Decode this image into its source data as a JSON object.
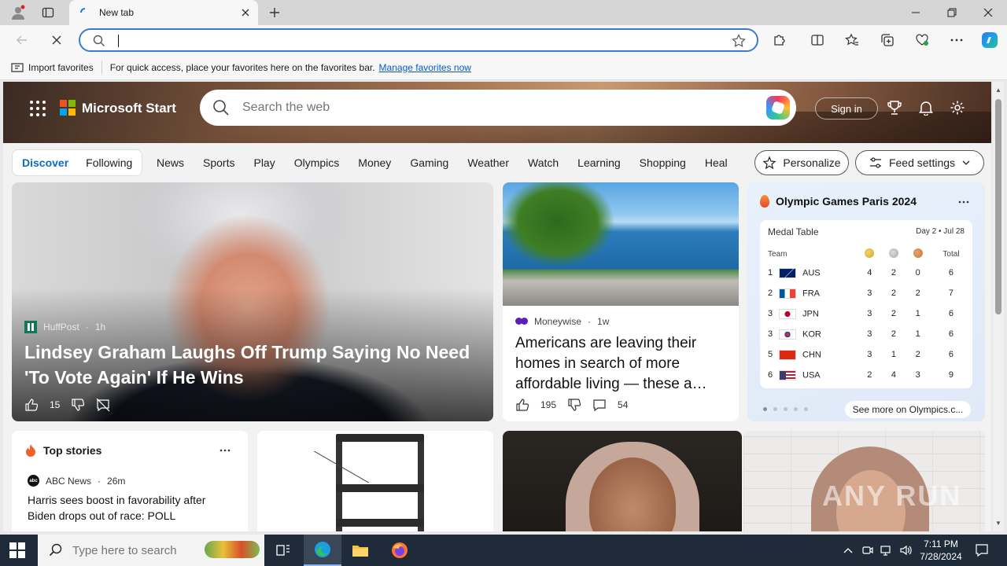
{
  "browser": {
    "tab_title": "New tab",
    "address_value": "",
    "favorites_bar": {
      "import_label": "Import favorites",
      "hint": "For quick access, place your favorites here on the favorites bar.",
      "manage_link": "Manage favorites now"
    }
  },
  "header": {
    "brand": "Microsoft Start",
    "search_placeholder": "Search the web",
    "sign_in": "Sign in"
  },
  "nav": {
    "discover": "Discover",
    "following": "Following",
    "items": [
      "News",
      "Sports",
      "Play",
      "Olympics",
      "Money",
      "Gaming",
      "Weather",
      "Watch",
      "Learning",
      "Shopping",
      "Heal"
    ],
    "personalize": "Personalize",
    "feed_settings": "Feed settings"
  },
  "lead_story": {
    "source": "HuffPost",
    "age": "1h",
    "headline": "Lindsey Graham Laughs Off Trump Saying No Need 'To Vote Again' If He Wins",
    "likes": "15"
  },
  "money_story": {
    "source": "Moneywise",
    "age": "1w",
    "headline": "Americans are leaving their homes in search of more affordable living — these a…",
    "likes": "195",
    "comments": "54"
  },
  "olympics": {
    "title": "Olympic Games Paris 2024",
    "table_title": "Medal Table",
    "day": "Day 2 • Jul 28",
    "team_header": "Team",
    "total_header": "Total",
    "rows": [
      {
        "rank": "1",
        "team": "AUS",
        "gold": "4",
        "silver": "2",
        "bronze": "0",
        "total": "6"
      },
      {
        "rank": "2",
        "team": "FRA",
        "gold": "3",
        "silver": "2",
        "bronze": "2",
        "total": "7"
      },
      {
        "rank": "3",
        "team": "JPN",
        "gold": "3",
        "silver": "2",
        "bronze": "1",
        "total": "6"
      },
      {
        "rank": "3",
        "team": "KOR",
        "gold": "3",
        "silver": "2",
        "bronze": "1",
        "total": "6"
      },
      {
        "rank": "5",
        "team": "CHN",
        "gold": "3",
        "silver": "1",
        "bronze": "2",
        "total": "6"
      },
      {
        "rank": "6",
        "team": "USA",
        "gold": "2",
        "silver": "4",
        "bronze": "3",
        "total": "9"
      }
    ],
    "see_more": "See more on Olympics.c..."
  },
  "top_stories": {
    "title": "Top stories",
    "source": "ABC News",
    "age": "26m",
    "headline": "Harris sees boost in favorability after Biden drops out of race: POLL"
  },
  "watermark": "ANY RUN",
  "taskbar": {
    "search_placeholder": "Type here to search",
    "time": "7:11 PM",
    "date": "7/28/2024"
  },
  "colors": {
    "accent": "#0f6cbd",
    "address_border": "#3a7bd5",
    "taskbar": "#1f2b38",
    "gold": "#d4a42a",
    "silver": "#a8a8a8",
    "bronze": "#c57a3a"
  }
}
